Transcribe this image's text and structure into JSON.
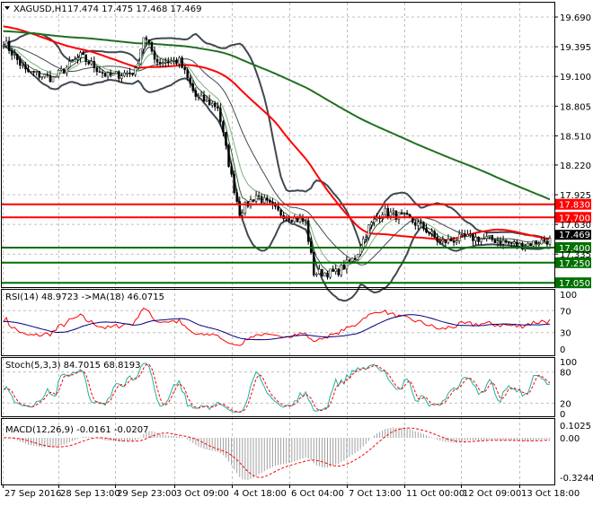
{
  "header": {
    "symbol": "XAGUSD,H1",
    "ohlc": "17.474 17.475 17.468 17.469"
  },
  "colors": {
    "red_level": "#ff0000",
    "green_level": "#007000",
    "ma_fast": "#ff0000",
    "ma_slow": "#207020",
    "bands": "#404850",
    "rsi": "#ff0000",
    "rsi_ma": "#000080",
    "stoch_main": "#20b0a0",
    "stoch_signal": "#ff0000",
    "macd_hist": "#a0a0a0",
    "macd_signal": "#ff0000"
  },
  "chart_data": [
    {
      "type": "candlestick",
      "title": "XAGUSD,H1",
      "ylim": [
        17.0,
        19.82
      ],
      "y_ticks": [
        "19.690",
        "19.395",
        "19.100",
        "18.805",
        "18.510",
        "18.220",
        "17.925",
        "17.630",
        "17.335"
      ],
      "x_ticks": [
        "27 Sep 2016",
        "28 Sep 13:00",
        "29 Sep 23:00",
        "3 Oct 09:00",
        "4 Oct 18:00",
        "6 Oct 04:00",
        "7 Oct 13:00",
        "11 Oct 00:00",
        "12 Oct 09:00",
        "13 Oct 18:00"
      ],
      "price_path": [
        [
          0,
          19.45
        ],
        [
          8,
          19.15
        ],
        [
          18,
          19.08
        ],
        [
          28,
          19.3
        ],
        [
          38,
          19.1
        ],
        [
          48,
          19.15
        ],
        [
          51,
          19.5
        ],
        [
          56,
          19.25
        ],
        [
          64,
          19.25
        ],
        [
          70,
          18.9
        ],
        [
          78,
          18.8
        ],
        [
          83,
          18.1
        ],
        [
          86,
          17.75
        ],
        [
          92,
          17.92
        ],
        [
          100,
          17.75
        ],
        [
          110,
          17.65
        ],
        [
          113,
          17.15
        ],
        [
          121,
          17.15
        ],
        [
          128,
          17.3
        ],
        [
          133,
          17.6
        ],
        [
          138,
          17.76
        ],
        [
          146,
          17.7
        ],
        [
          153,
          17.6
        ],
        [
          159,
          17.45
        ],
        [
          168,
          17.5
        ],
        [
          178,
          17.48
        ],
        [
          188,
          17.42
        ],
        [
          197,
          17.47
        ]
      ],
      "levels": [
        {
          "label": "17.830",
          "value": 17.83,
          "color": "red"
        },
        {
          "label": "17.700",
          "value": 17.7,
          "color": "red"
        },
        {
          "label": "17.400",
          "value": 17.4,
          "color": "green"
        },
        {
          "label": "17.250",
          "value": 17.25,
          "color": "green"
        },
        {
          "label": "17.050",
          "value": 17.05,
          "color": "green"
        }
      ],
      "current_price": {
        "label": "17.469",
        "value": 17.469
      }
    },
    {
      "type": "line",
      "title": "RSI(14) 48.9723  ->MA(18) 46.0715",
      "ylim": [
        0,
        100
      ],
      "y_ticks": [
        "100",
        "70",
        "30",
        "0"
      ]
    },
    {
      "type": "line",
      "title": "Stoch(5,3,3) 84.7015 68.8193",
      "ylim": [
        0,
        100
      ],
      "y_ticks": [
        "100",
        "80",
        "20",
        "0"
      ]
    },
    {
      "type": "bar",
      "title": "MACD(12,26,9) -0.0161 -0.0207",
      "ylim": [
        -0.3244,
        0.1025
      ],
      "y_ticks": [
        "0.1025",
        "0.00",
        "-0.3244"
      ]
    }
  ]
}
